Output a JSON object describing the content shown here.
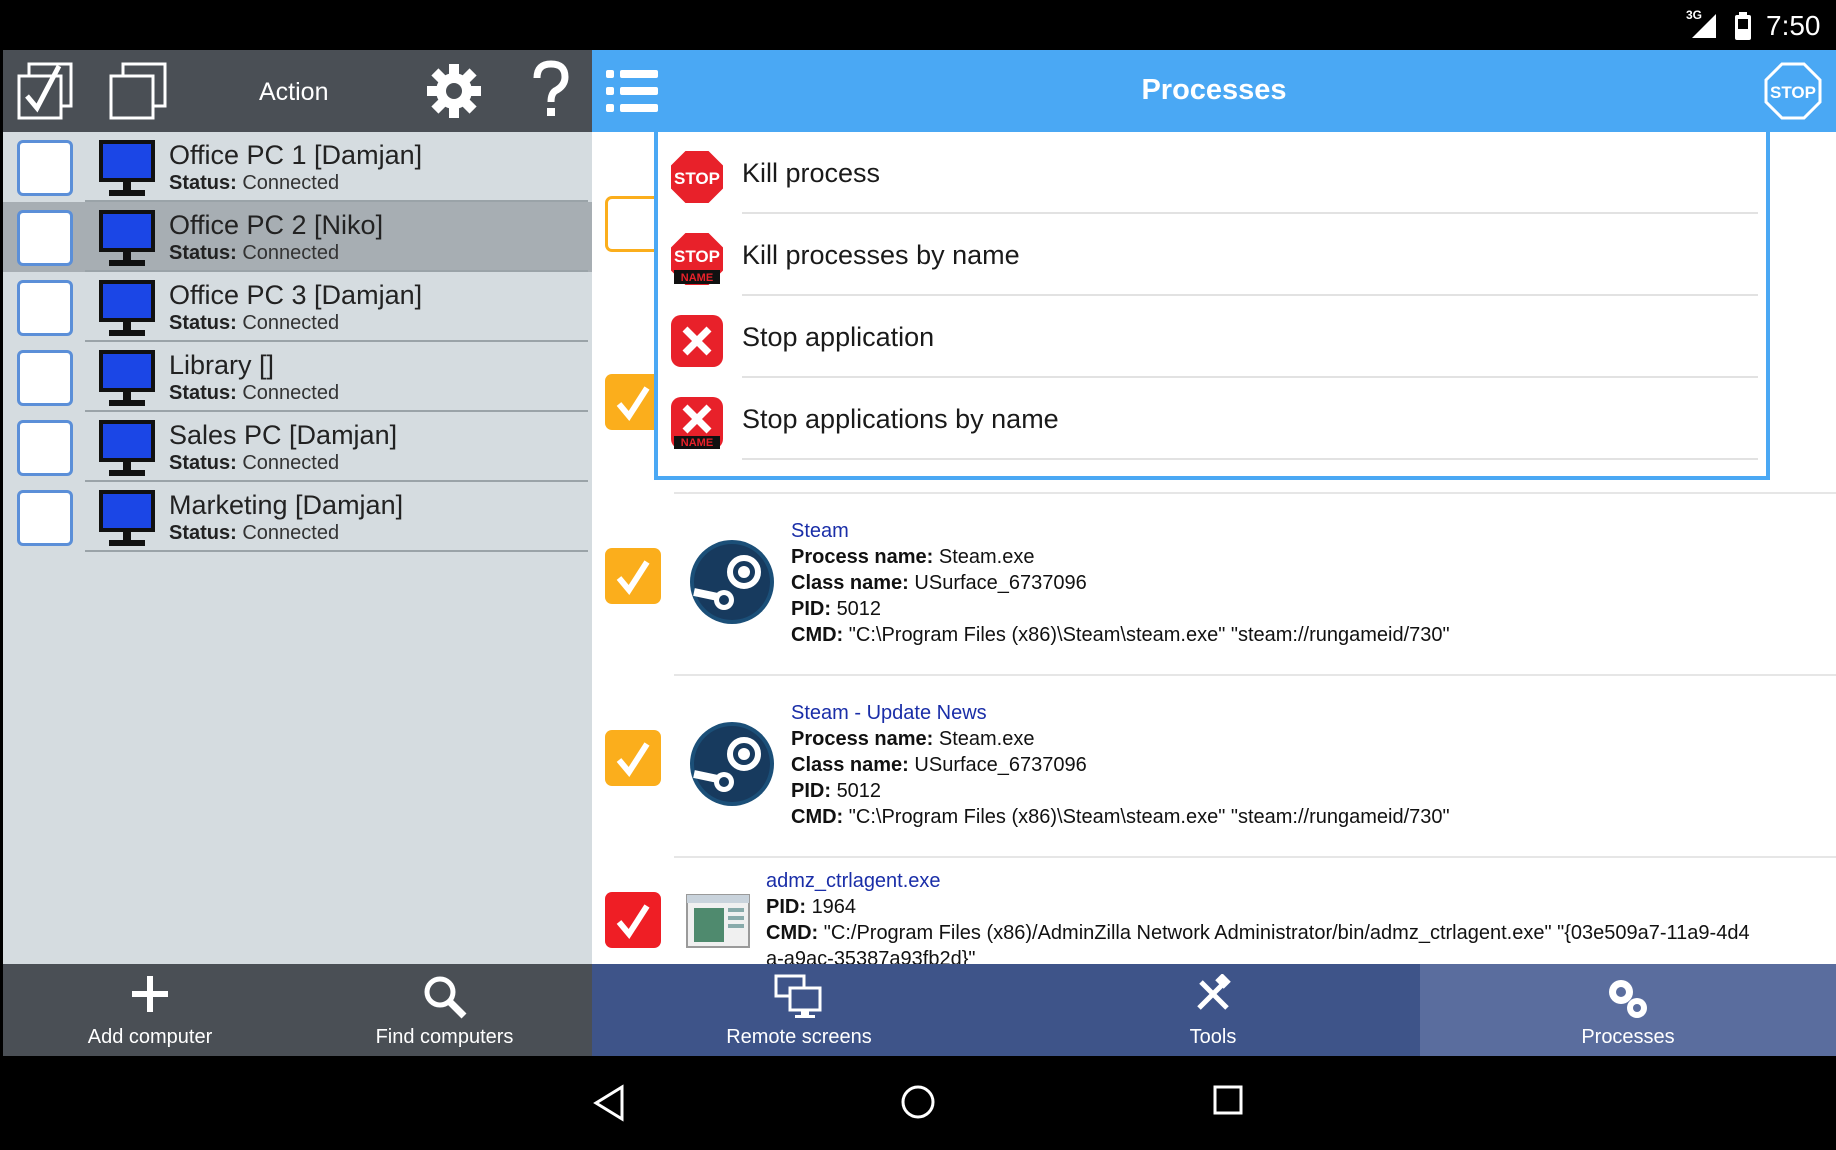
{
  "status_bar": {
    "network": "3G",
    "time": "7:50"
  },
  "left_toolbar": {
    "action_label": "Action"
  },
  "computers": [
    {
      "name": "Office PC 1 [Damjan]",
      "status_label": "Status:",
      "status": "Connected",
      "selected": false
    },
    {
      "name": "Office PC 2 [Niko]",
      "status_label": "Status:",
      "status": "Connected",
      "selected": true
    },
    {
      "name": "Office PC 3 [Damjan]",
      "status_label": "Status:",
      "status": "Connected",
      "selected": false
    },
    {
      "name": "Library []",
      "status_label": "Status:",
      "status": "Connected",
      "selected": false
    },
    {
      "name": "Sales PC [Damjan]",
      "status_label": "Status:",
      "status": "Connected",
      "selected": false
    },
    {
      "name": "Marketing [Damjan]",
      "status_label": "Status:",
      "status": "Connected",
      "selected": false
    }
  ],
  "right_toolbar": {
    "title": "Processes"
  },
  "menu": {
    "items": [
      {
        "label": "Kill process",
        "icon": "stop-sign-icon"
      },
      {
        "label": "Kill processes by name",
        "icon": "stop-sign-name-icon"
      },
      {
        "label": "Stop application",
        "icon": "red-x-icon"
      },
      {
        "label": "Stop applications by name",
        "icon": "red-x-name-icon"
      }
    ]
  },
  "processes": [
    {
      "title": "Steam",
      "process_name_label": "Process name:",
      "process_name": "Steam.exe",
      "class_name_label": "Class name:",
      "class_name": "USurface_6737096",
      "pid_label": "PID:",
      "pid": "5012",
      "cmd_label": "CMD:",
      "cmd": "\"C:\\Program Files (x86)\\Steam\\steam.exe\" \"steam://rungameid/730\""
    },
    {
      "title": "Steam - Update News",
      "process_name_label": "Process name:",
      "process_name": "Steam.exe",
      "class_name_label": "Class name:",
      "class_name": "USurface_6737096",
      "pid_label": "PID:",
      "pid": "5012",
      "cmd_label": "CMD:",
      "cmd": "\"C:\\Program Files (x86)\\Steam\\steam.exe\" \"steam://rungameid/730\""
    },
    {
      "title": "admz_ctrlagent.exe",
      "pid_label": "PID:",
      "pid": "1964",
      "cmd_label": "CMD:",
      "cmd": "\"C:/Program Files (x86)/AdminZilla Network Administrator/bin/admz_ctrlagent.exe\" \"{03e509a7-11a9-4d4",
      "cmd_cont": "a-a9ac-35387a93fb2d}\""
    }
  ],
  "bottom_toolbar": {
    "add_computer": "Add computer",
    "find_computers": "Find computers",
    "remote_screens": "Remote screens",
    "tools": "Tools",
    "processes": "Processes"
  },
  "colors": {
    "accent_blue": "#4aa8f4",
    "checkbox_orange": "#fbae1c",
    "checkbox_red": "#ef1e25",
    "dark_toolbar": "#4a4f55",
    "nav_blue": "#3e5489"
  }
}
